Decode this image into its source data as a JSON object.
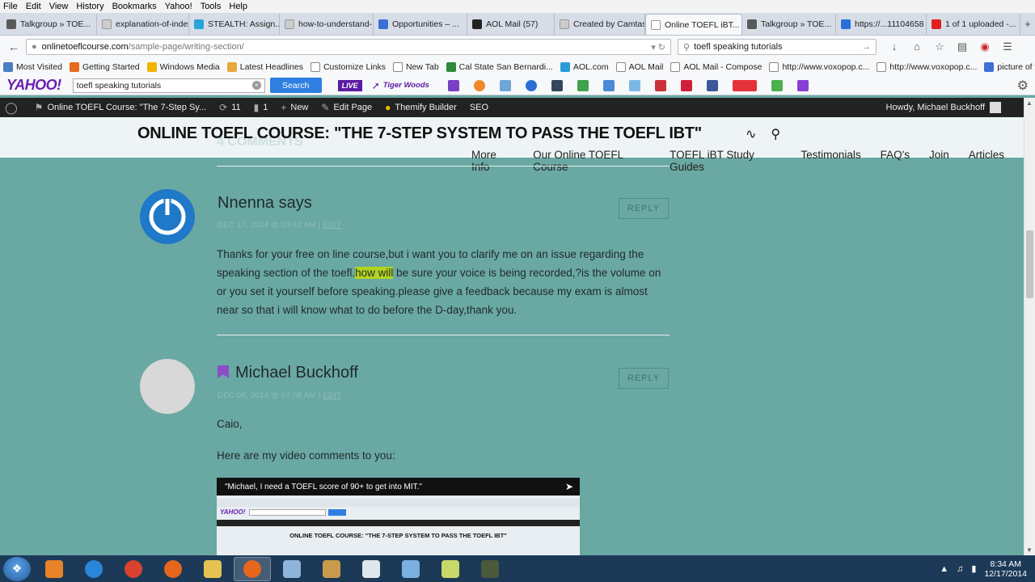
{
  "menu": [
    "File",
    "Edit",
    "View",
    "History",
    "Bookmarks",
    "Yahoo!",
    "Tools",
    "Help"
  ],
  "tabs": [
    {
      "label": "Talkgroup » TOE...",
      "color": "#5a5a5a",
      "active": false
    },
    {
      "label": "explanation-of-indep...",
      "color": "#cccccc",
      "active": false
    },
    {
      "label": "STEALTH: Assign...",
      "color": "#2aa3d9",
      "active": false
    },
    {
      "label": "how-to-understand-...",
      "color": "#cccccc",
      "active": false
    },
    {
      "label": "Opportunities – ...",
      "color": "#3b6fd6",
      "active": false
    },
    {
      "label": "AOL Mail (57)",
      "color": "#222222",
      "active": false
    },
    {
      "label": "Created by Camtasia ...",
      "color": "#cccccc",
      "active": false
    },
    {
      "label": "Online TOEFL iBT...",
      "color": "#ffffff",
      "active": true
    },
    {
      "label": "Talkgroup » TOE...",
      "color": "#5a5a5a",
      "active": false
    },
    {
      "label": "https://...11104658",
      "color": "#2a6fd9",
      "active": false
    },
    {
      "label": "1 of 1 uploaded -...",
      "color": "#e02020",
      "active": false
    }
  ],
  "nav": {
    "url_host": "onlinetoeflcourse.com",
    "url_path": "/sample-page/writing-section/",
    "search_value": "toefl speaking tutorials"
  },
  "bookmarks": [
    {
      "label": "Most Visited",
      "color": "#4a7fc0"
    },
    {
      "label": "Getting Started",
      "color": "#e56a1a"
    },
    {
      "label": "Windows Media",
      "color": "#f2b400"
    },
    {
      "label": "Latest Headlines",
      "color": "#e8a93a"
    },
    {
      "label": "Customize Links",
      "color": "#ffffff"
    },
    {
      "label": "New Tab",
      "color": "#ffffff"
    },
    {
      "label": "Cal State San Bernardi...",
      "color": "#2e8b3a"
    },
    {
      "label": "AOL.com",
      "color": "#2a9bd8"
    },
    {
      "label": "AOL Mail",
      "color": "#ffffff"
    },
    {
      "label": "AOL Mail - Compose",
      "color": "#ffffff"
    },
    {
      "label": "http://www.voxopop.c...",
      "color": "#ffffff"
    },
    {
      "label": "http://www.voxopop.c...",
      "color": "#ffffff"
    },
    {
      "label": "picture of test review -...",
      "color": "#3d6fd6"
    }
  ],
  "yahoo": {
    "logo": "YAHOO!",
    "search_value": "toefl speaking tutorials",
    "search_button": "Search",
    "live": "LIVE",
    "tiger": "Tiger Woods"
  },
  "wpbar": {
    "site": "Online TOEFL Course: \"The 7-Step Sy...",
    "updates": "11",
    "comments": "1",
    "new": "New",
    "edit": "Edit Page",
    "builder": "Themify Builder",
    "seo": "SEO",
    "howdy": "Howdy, Michael Buckhoff"
  },
  "site": {
    "title": "ONLINE TOEFL COURSE: \"THE 7-STEP SYSTEM TO PASS THE TOEFL IBT\"",
    "ghost": "4 COMMENTS",
    "nav": [
      "More Info",
      "Our Online TOEFL Course",
      "TOEFL iBT Study Guides",
      "Testimonials",
      "FAQ's",
      "Join",
      "Articles"
    ]
  },
  "comments": [
    {
      "author": "Nnenna says",
      "meta_date": "DEC 17, 2014 @ 03:42 AM",
      "meta_edit": "EDIT",
      "reply": "REPLY",
      "text_pre": "Thanks for your free on line course,but i want you to clarify me on an issue regarding the speaking section of the toefl.",
      "text_hl": "how will",
      "text_post": " be sure your voice is being recorded,?is the volume on or you set it yourself before speaking.please give a feedback because my exam is almost near so that i will know what to do before the D-day,thank you."
    },
    {
      "author": "Michael Buckhoff",
      "meta_date": "DEC 08, 2014 @ 07:08 AM",
      "meta_edit": "EDIT",
      "reply": "REPLY",
      "line1": "Caio,",
      "line2": "Here are my video comments to you:",
      "video_title": "\"Michael, I need a TOEFL score of 90+ to get into MIT.\"",
      "video_inner_title": "ONLINE TOEFL COURSE: \"THE 7-STEP SYSTEM TO PASS THE TOEFL IBT\""
    }
  ],
  "taskbar": {
    "apps": [
      {
        "name": "media-player-icon",
        "color": "#e8832a"
      },
      {
        "name": "internet-explorer-icon",
        "color": "#2a86d8"
      },
      {
        "name": "chrome-icon",
        "color": "#d9422f"
      },
      {
        "name": "firefox-icon",
        "color": "#e5661c"
      },
      {
        "name": "file-explorer-icon",
        "color": "#e6c252"
      },
      {
        "name": "firefox-active-icon",
        "color": "#e5661c"
      },
      {
        "name": "email-icon",
        "color": "#8fb4d9"
      },
      {
        "name": "tool-icon",
        "color": "#c99a4a"
      },
      {
        "name": "document-icon",
        "color": "#dfe6ec"
      },
      {
        "name": "image-viewer-icon",
        "color": "#7ab0e0"
      },
      {
        "name": "sticky-notes-icon",
        "color": "#c8d96a"
      },
      {
        "name": "camtasia-icon",
        "color": "#4a5a3a"
      }
    ],
    "time": "8:34 AM",
    "date": "12/17/2014"
  }
}
